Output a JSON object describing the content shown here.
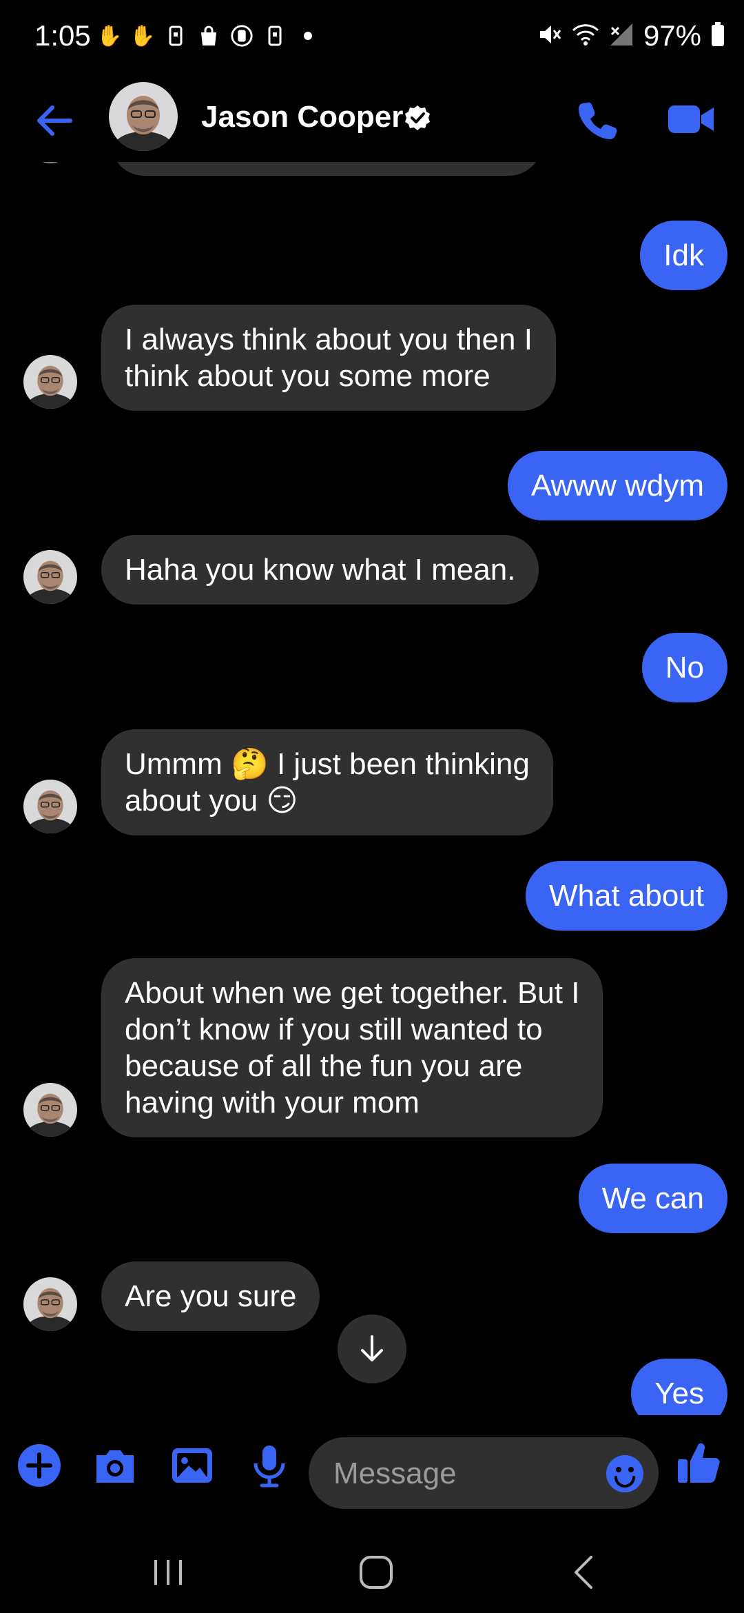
{
  "status_bar": {
    "time": "1:05",
    "battery": "97%"
  },
  "header": {
    "contact_name": "Jason Cooper"
  },
  "messages": [
    {
      "side": "out",
      "text": "Idk"
    },
    {
      "side": "in",
      "lines": [
        "I always think about you then I",
        "think about you some more"
      ]
    },
    {
      "side": "out",
      "text": "Awww wdym"
    },
    {
      "side": "in",
      "text": "Haha you know what I mean."
    },
    {
      "side": "out",
      "text": "No"
    },
    {
      "side": "in",
      "lines": [
        "Ummm 🤔 I just been thinking",
        "about you 😏"
      ]
    },
    {
      "side": "out",
      "text": "What about"
    },
    {
      "side": "in",
      "lines": [
        "About when we get together. But I",
        "don’t know if you still wanted to",
        "because of all the fun you are",
        "having with your mom"
      ]
    },
    {
      "side": "out",
      "text": "We can"
    },
    {
      "side": "in",
      "text": "Are you sure"
    },
    {
      "side": "out",
      "text": "Yes"
    }
  ],
  "composer": {
    "placeholder": "Message"
  },
  "colors": {
    "accent": "#3a64f4",
    "incoming_bubble": "#303030",
    "background": "#000000"
  }
}
